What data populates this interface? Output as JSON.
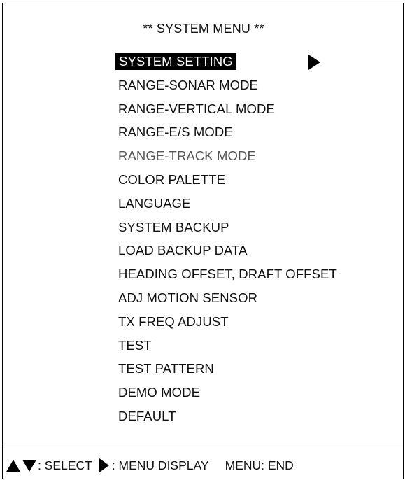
{
  "menu": {
    "title": "** SYSTEM MENU **",
    "items": [
      {
        "label": "SYSTEM SETTING",
        "state": "selected",
        "has_submenu": true
      },
      {
        "label": "RANGE-SONAR MODE",
        "state": "normal"
      },
      {
        "label": "RANGE-VERTICAL MODE",
        "state": "normal"
      },
      {
        "label": "RANGE-E/S MODE",
        "state": "normal"
      },
      {
        "label": "RANGE-TRACK MODE",
        "state": "dimmed"
      },
      {
        "label": "COLOR PALETTE",
        "state": "normal"
      },
      {
        "label": "LANGUAGE",
        "state": "normal"
      },
      {
        "label": "SYSTEM BACKUP",
        "state": "normal"
      },
      {
        "label": "LOAD BACKUP DATA",
        "state": "normal"
      },
      {
        "label": "HEADING OFFSET, DRAFT OFFSET",
        "state": "normal"
      },
      {
        "label": "ADJ MOTION SENSOR",
        "state": "normal"
      },
      {
        "label": "TX FREQ ADJUST",
        "state": "normal"
      },
      {
        "label": "TEST",
        "state": "normal"
      },
      {
        "label": "TEST PATTERN",
        "state": "normal"
      },
      {
        "label": "DEMO MODE",
        "state": "normal"
      },
      {
        "label": "DEFAULT",
        "state": "normal"
      }
    ],
    "submenu_indicator_icon": "triangle-right-icon"
  },
  "help_bar": {
    "select_text": ": SELECT",
    "select_icons": [
      "triangle-up-icon",
      "triangle-down-icon"
    ],
    "menu_display_text": ": MENU DISPLAY",
    "menu_display_icon": "triangle-right-icon",
    "end_text": "MENU: END"
  },
  "colors": {
    "background": "#ffffff",
    "text": "#111111",
    "dimmed_text": "#555555",
    "highlight_bg": "#000000",
    "highlight_text": "#ffffff"
  }
}
